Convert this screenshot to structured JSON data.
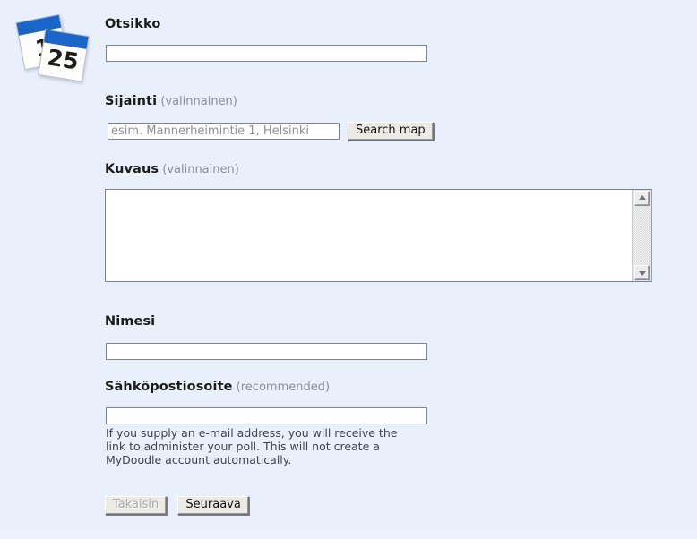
{
  "app": {
    "logo": {
      "icon": "calendar-stack-icon",
      "back_page_number": "1",
      "front_page_number": "25",
      "accent_color": "#1a66c8"
    },
    "background_color": "#e9f0fb"
  },
  "form": {
    "fields": {
      "title": {
        "label": "Otsikko",
        "sub": "",
        "value": "",
        "placeholder": ""
      },
      "location": {
        "label": "Sijainti",
        "sub": "(valinnainen)",
        "value": "",
        "placeholder": "esim. Mannerheimintie 1, Helsinki",
        "button_label": "Search map"
      },
      "description": {
        "label": "Kuvaus",
        "sub": "(valinnainen)",
        "value": "",
        "placeholder": ""
      },
      "name": {
        "label": "Nimesi",
        "sub": "",
        "value": "",
        "placeholder": ""
      },
      "email": {
        "label": "Sähköpostiosoite",
        "sub": "(recommended)",
        "value": "",
        "placeholder": "",
        "help": "If you supply an e-mail address, you will receive the link to administer your poll. This will not create a MyDoodle account automatically."
      }
    },
    "buttons": {
      "back_label": "Takaisin",
      "next_label": "Seuraava"
    }
  },
  "scrollbar": {
    "up_icon": "chevron-up-icon",
    "down_icon": "chevron-down-icon"
  }
}
